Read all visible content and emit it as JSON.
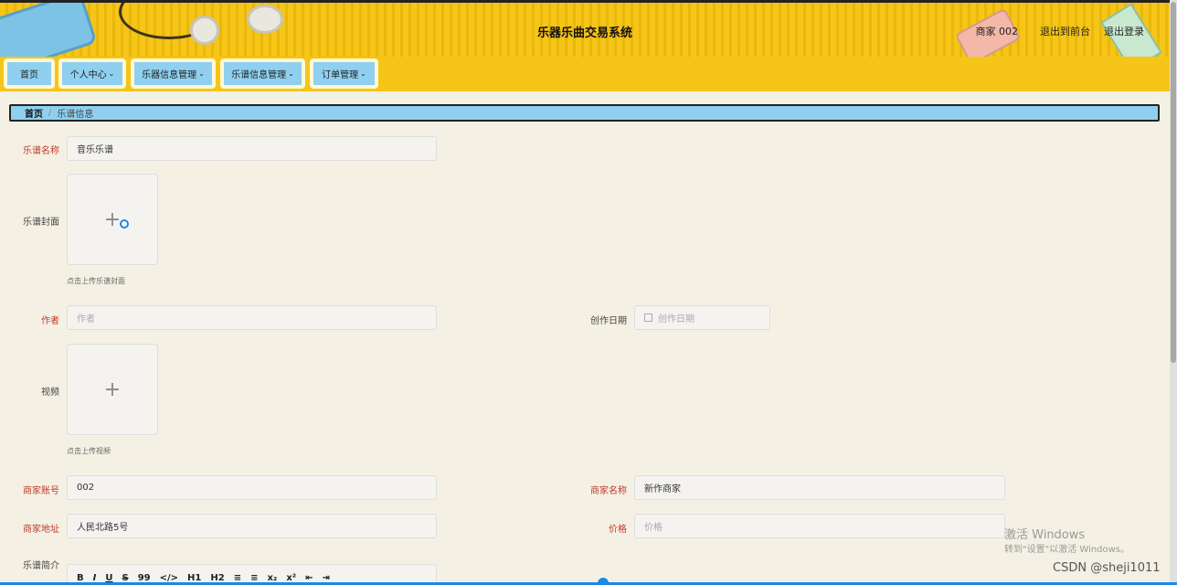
{
  "header": {
    "title": "乐器乐曲交易系统",
    "user": "商家 002",
    "to_front": "退出到前台",
    "logout": "退出登录"
  },
  "nav": {
    "home": "首页",
    "personal": "个人中心",
    "instrument": "乐器信息管理",
    "score": "乐谱信息管理",
    "orders": "订单管理",
    "caret": "⌄"
  },
  "breadcrumb": {
    "home": "首页",
    "separator": "/",
    "current": "乐谱信息"
  },
  "form": {
    "score_name_label": "乐谱名称",
    "score_name_value": "音乐乐谱",
    "cover_label": "乐谱封面",
    "cover_hint": "点击上传乐谱封面",
    "author_label": "作者",
    "author_placeholder": "作者",
    "date_label": "创作日期",
    "date_placeholder": "创作日期",
    "video_label": "视频",
    "video_hint": "点击上传视频",
    "merchant_account_label": "商家账号",
    "merchant_account_value": "002",
    "merchant_name_label": "商家名称",
    "merchant_name_value": "新作商家",
    "merchant_address_label": "商家地址",
    "merchant_address_value": "人民北路5号",
    "price_label": "价格",
    "price_placeholder": "价格",
    "intro_label": "乐谱简介",
    "upload_plus": "+"
  },
  "editor_toolbar": [
    "B",
    "I",
    "U",
    "S",
    "99",
    "</>",
    "H1",
    "H2",
    "≡",
    "≡",
    "x₂",
    "x²",
    "⇤",
    "⇥"
  ],
  "overlay": {
    "activate_title": "激活 Windows",
    "activate_sub": "转到\"设置\"以激活 Windows。",
    "csdn": "CSDN @sheji1011"
  },
  "colors": {
    "header_yellow": "#f5c518",
    "nav_blue": "#8fd0f0",
    "required_red": "#c0392b",
    "page_bg": "#f4f1e4"
  }
}
